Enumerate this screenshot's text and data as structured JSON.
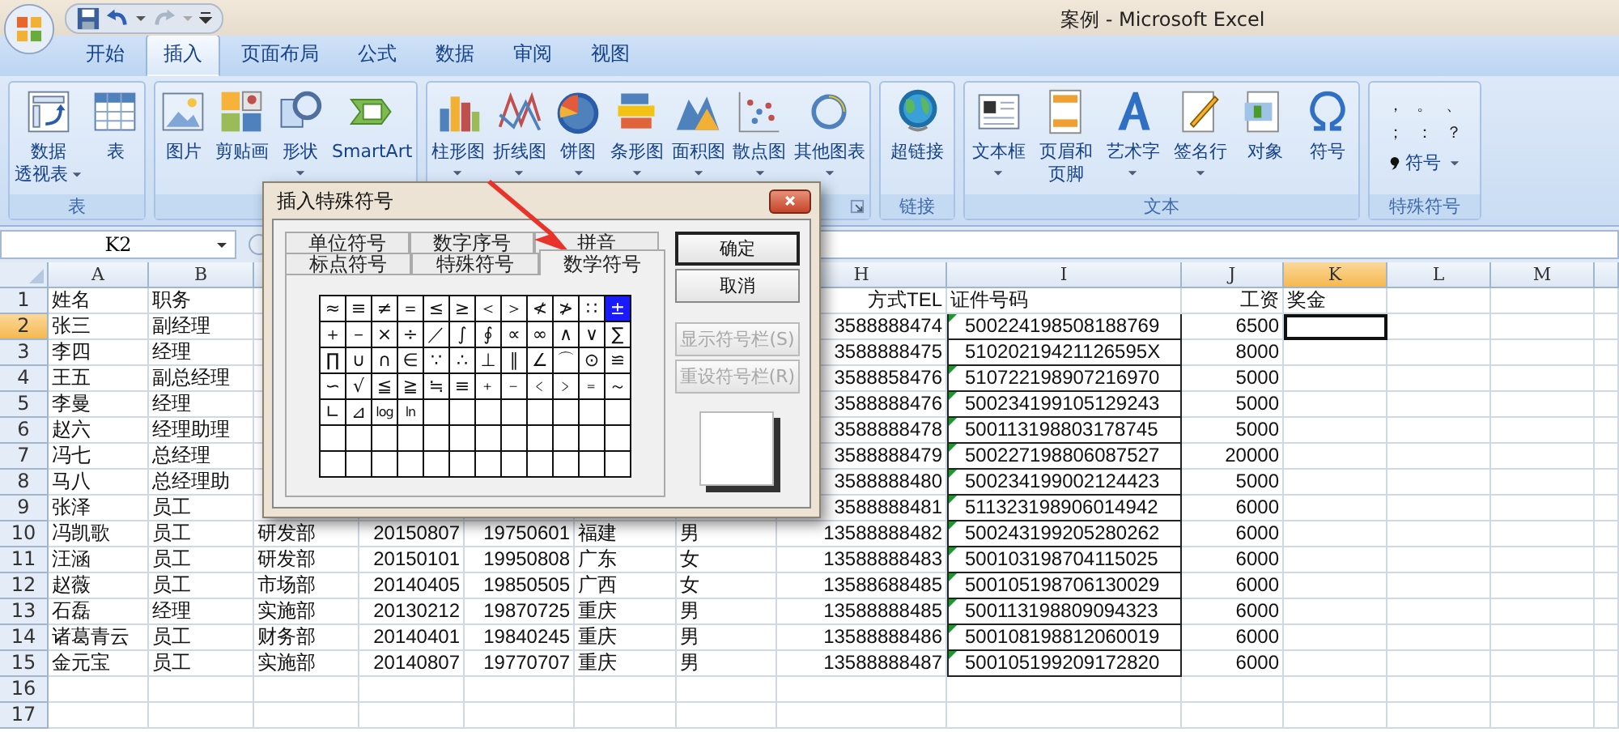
{
  "window": {
    "title": "案例 - Microsoft Excel"
  },
  "ribbon_tabs": [
    {
      "label": "开始",
      "selected": false
    },
    {
      "label": "插入",
      "selected": true
    },
    {
      "label": "页面布局",
      "selected": false
    },
    {
      "label": "公式",
      "selected": false
    },
    {
      "label": "数据",
      "selected": false
    },
    {
      "label": "审阅",
      "selected": false
    },
    {
      "label": "视图",
      "selected": false
    }
  ],
  "ribbon_groups": [
    {
      "kind": "buttons",
      "label": "表",
      "buttons": [
        {
          "lines": [
            "数据",
            "透视表"
          ],
          "dropdown": true
        },
        {
          "lines": [
            "表"
          ],
          "dropdown": false
        }
      ]
    },
    {
      "kind": "buttons",
      "buttons": [
        {
          "lines": [
            "图片"
          ],
          "dropdown": false
        },
        {
          "lines": [
            "剪贴画"
          ],
          "dropdown": false
        },
        {
          "lines": [
            "形状"
          ],
          "dropdown": true
        },
        {
          "lines": [
            "SmartArt"
          ],
          "dropdown": false
        }
      ]
    },
    {
      "kind": "buttons",
      "launcher": true,
      "buttons": [
        {
          "lines": [
            "柱形图"
          ],
          "dropdown": true
        },
        {
          "lines": [
            "折线图"
          ],
          "dropdown": true
        },
        {
          "lines": [
            "饼图"
          ],
          "dropdown": true
        },
        {
          "lines": [
            "条形图"
          ],
          "dropdown": true
        },
        {
          "lines": [
            "面积图"
          ],
          "dropdown": true
        },
        {
          "lines": [
            "散点图"
          ],
          "dropdown": true
        },
        {
          "lines": [
            "其他图表"
          ],
          "dropdown": true
        }
      ]
    },
    {
      "kind": "buttons",
      "label": "链接",
      "buttons": [
        {
          "lines": [
            "超链接"
          ],
          "dropdown": false
        }
      ]
    },
    {
      "kind": "buttons",
      "label": "文本",
      "buttons": [
        {
          "lines": [
            "文本框"
          ],
          "dropdown": true
        },
        {
          "lines": [
            "页眉和",
            "页脚"
          ],
          "dropdown": false
        },
        {
          "lines": [
            "艺术字"
          ],
          "dropdown": true
        },
        {
          "lines": [
            "签名行"
          ],
          "dropdown": true
        },
        {
          "lines": [
            "对象"
          ],
          "dropdown": false
        },
        {
          "lines": [
            "符号"
          ],
          "dropdown": false
        }
      ]
    },
    {
      "kind": "symbols",
      "label": "特殊符号",
      "symbols": [
        "，",
        "。",
        "、",
        "；",
        "：",
        "？"
      ],
      "menu": {
        "label": "符号",
        "dropdown": true
      }
    }
  ],
  "formula_bar": {
    "name_box": "K2"
  },
  "sheet": {
    "columns": [
      {
        "label": "A",
        "selected": false
      },
      {
        "label": "B",
        "selected": false
      },
      {
        "label": "H",
        "selected": false
      },
      {
        "label": "I",
        "selected": false
      },
      {
        "label": "J",
        "selected": false
      },
      {
        "label": "K",
        "selected": true
      },
      {
        "label": "L",
        "selected": false
      },
      {
        "label": "M",
        "selected": false
      }
    ],
    "rows": [
      {
        "label": "1",
        "selected": false,
        "outlined": false,
        "flagged": false,
        "cells": {
          "A": "姓名",
          "B": "职务",
          "H": "方式TEL",
          "I": "证件号码",
          "J": "工资",
          "K": "奖金"
        }
      },
      {
        "label": "2",
        "selected": true,
        "outlined": true,
        "flagged": true,
        "cells": {
          "A": "张三",
          "B": "副经理",
          "H": "3588888474",
          "I": "500224198508188769",
          "J": "6500"
        }
      },
      {
        "label": "3",
        "selected": false,
        "outlined": true,
        "flagged": false,
        "cells": {
          "A": "李四",
          "B": "经理",
          "H": "3588888475",
          "I": "51020219421126595X",
          "J": "8000"
        }
      },
      {
        "label": "4",
        "selected": false,
        "outlined": true,
        "flagged": true,
        "cells": {
          "A": "王五",
          "B": "副总经理",
          "H": "3588858476",
          "I": "510722198907216970",
          "J": "5000"
        }
      },
      {
        "label": "5",
        "selected": false,
        "outlined": true,
        "flagged": true,
        "cells": {
          "A": "李曼",
          "B": "经理",
          "H": "3588888476",
          "I": "500234199105129243",
          "J": "5000"
        }
      },
      {
        "label": "6",
        "selected": false,
        "outlined": true,
        "flagged": true,
        "cells": {
          "A": "赵六",
          "B": "经理助理",
          "H": "3588888478",
          "I": "500113198803178745",
          "J": "5000"
        }
      },
      {
        "label": "7",
        "selected": false,
        "outlined": true,
        "flagged": true,
        "cells": {
          "A": "冯七",
          "B": "总经理",
          "H": "3588888479",
          "I": "500227198806087527",
          "J": "20000"
        }
      },
      {
        "label": "8",
        "selected": false,
        "outlined": true,
        "flagged": true,
        "cells": {
          "A": "马八",
          "B": "总经理助",
          "H": "3588888480",
          "I": "500234199002124423",
          "J": "5000"
        }
      },
      {
        "label": "9",
        "selected": false,
        "outlined": true,
        "flagged": true,
        "cells": {
          "A": "张泽",
          "B": "员工",
          "H": "3588888481",
          "I": "511323198906014942",
          "J": "6000"
        }
      },
      {
        "label": "10",
        "selected": false,
        "outlined": true,
        "flagged": true,
        "cells": {
          "A": "冯凯歌",
          "B": "员工",
          "C": "研发部",
          "D": "20150807",
          "E": "19750601",
          "F": "福建",
          "G": "男",
          "H": "13588888482",
          "I": "500243199205280262",
          "J": "6000"
        }
      },
      {
        "label": "11",
        "selected": false,
        "outlined": true,
        "flagged": true,
        "cells": {
          "A": "汪涵",
          "B": "员工",
          "C": "研发部",
          "D": "20150101",
          "E": "19950808",
          "F": "广东",
          "G": "女",
          "H": "13588888483",
          "I": "500103198704115025",
          "J": "6000"
        }
      },
      {
        "label": "12",
        "selected": false,
        "outlined": true,
        "flagged": true,
        "cells": {
          "A": "赵薇",
          "B": "员工",
          "C": "市场部",
          "D": "20140405",
          "E": "19850505",
          "F": "广西",
          "G": "女",
          "H": "13588688485",
          "I": "500105198706130029",
          "J": "6000"
        }
      },
      {
        "label": "13",
        "selected": false,
        "outlined": true,
        "flagged": true,
        "cells": {
          "A": "石磊",
          "B": "经理",
          "C": "实施部",
          "D": "20130212",
          "E": "19870725",
          "F": "重庆",
          "G": "男",
          "H": "13588888485",
          "I": "500113198809094323",
          "J": "6000"
        }
      },
      {
        "label": "14",
        "selected": false,
        "outlined": true,
        "flagged": true,
        "cells": {
          "A": "诸葛青云",
          "B": "员工",
          "C": "财务部",
          "D": "20140401",
          "E": "19840245",
          "F": "重庆",
          "G": "男",
          "H": "13588888486",
          "I": "500108198812060019",
          "J": "6000"
        }
      },
      {
        "label": "15",
        "selected": false,
        "outlined": true,
        "flagged": true,
        "cells": {
          "A": "金元宝",
          "B": "员工",
          "C": "实施部",
          "D": "20140807",
          "E": "19770707",
          "F": "重庆",
          "G": "男",
          "H": "13588888487",
          "I": "500105199209172820",
          "J": "6000"
        }
      },
      {
        "label": "16",
        "selected": false,
        "outlined": false,
        "flagged": false
      },
      {
        "label": "17",
        "selected": false,
        "outlined": false,
        "flagged": false
      }
    ]
  },
  "dialog": {
    "title": "插入特殊符号",
    "tab_rows": [
      {
        "tabs": [
          {
            "label": "单位符号",
            "selected": false
          },
          {
            "label": "数字序号",
            "selected": false
          },
          {
            "label": "拼音",
            "selected": false
          }
        ]
      },
      {
        "tabs": [
          {
            "label": "标点符号",
            "selected": false
          },
          {
            "label": "特殊符号",
            "selected": false
          },
          {
            "label": "数学符号",
            "selected": true
          }
        ]
      }
    ],
    "symbols": [
      {
        "char": "≈",
        "selected": false
      },
      {
        "char": "≡",
        "selected": false
      },
      {
        "char": "≠",
        "selected": false
      },
      {
        "char": "＝",
        "selected": false
      },
      {
        "char": "≤",
        "selected": false
      },
      {
        "char": "≥",
        "selected": false
      },
      {
        "char": "＜",
        "selected": false
      },
      {
        "char": "＞",
        "selected": false
      },
      {
        "char": "≮",
        "selected": false
      },
      {
        "char": "≯",
        "selected": false
      },
      {
        "char": "∷",
        "selected": false
      },
      {
        "char": "±",
        "selected": true
      },
      {
        "char": "＋",
        "selected": false
      },
      {
        "char": "－",
        "selected": false
      },
      {
        "char": "×",
        "selected": false
      },
      {
        "char": "÷",
        "selected": false
      },
      {
        "char": "／",
        "selected": false
      },
      {
        "char": "∫",
        "selected": false
      },
      {
        "char": "∮",
        "selected": false
      },
      {
        "char": "∝",
        "selected": false
      },
      {
        "char": "∞",
        "selected": false
      },
      {
        "char": "∧",
        "selected": false
      },
      {
        "char": "∨",
        "selected": false
      },
      {
        "char": "∑",
        "selected": false
      },
      {
        "char": "∏",
        "selected": false
      },
      {
        "char": "∪",
        "selected": false
      },
      {
        "char": "∩",
        "selected": false
      },
      {
        "char": "∈",
        "selected": false
      },
      {
        "char": "∵",
        "selected": false
      },
      {
        "char": "∴",
        "selected": false
      },
      {
        "char": "⊥",
        "selected": false
      },
      {
        "char": "∥",
        "selected": false
      },
      {
        "char": "∠",
        "selected": false
      },
      {
        "char": "⌒",
        "selected": false
      },
      {
        "char": "⊙",
        "selected": false
      },
      {
        "char": "≌",
        "selected": false
      },
      {
        "char": "∽",
        "selected": false
      },
      {
        "char": "√",
        "selected": false
      },
      {
        "char": "≦",
        "selected": false
      },
      {
        "char": "≧",
        "selected": false
      },
      {
        "char": "≒",
        "selected": false
      },
      {
        "char": "≡",
        "selected": false
      },
      {
        "char": "﹢",
        "selected": false
      },
      {
        "char": "﹣",
        "selected": false
      },
      {
        "char": "﹤",
        "selected": false
      },
      {
        "char": "﹥",
        "selected": false
      },
      {
        "char": "﹦",
        "selected": false
      },
      {
        "char": "～",
        "selected": false
      },
      {
        "char": "∟",
        "selected": false
      },
      {
        "char": "⊿",
        "selected": false
      },
      {
        "char": "log",
        "selected": false
      },
      {
        "char": "ln",
        "selected": false
      }
    ],
    "buttons": [
      {
        "label": "确定",
        "default": true,
        "disabled": false
      },
      {
        "label": "取消",
        "default": false,
        "disabled": false
      },
      {
        "label": "显示符号栏(S)",
        "default": false,
        "disabled": true
      },
      {
        "label": "重设符号栏(R)",
        "default": false,
        "disabled": true
      }
    ]
  }
}
